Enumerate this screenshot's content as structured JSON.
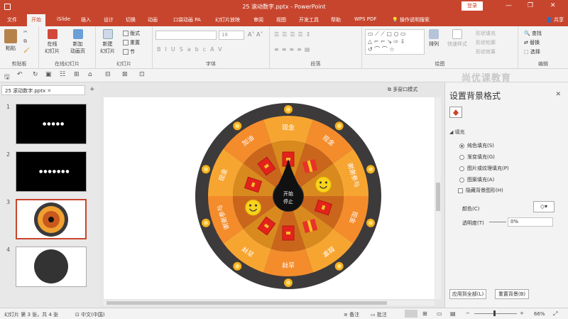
{
  "titlebar": {
    "title": "25 滚动数字.pptx  -  PowerPoint",
    "login": "登录",
    "min": "—",
    "max": "❐",
    "close": "✕"
  },
  "tabs": [
    "文件",
    "开始",
    "iSlide",
    "插入",
    "设计",
    "切换",
    "动画",
    "口袋动画 PA",
    "幻灯片放映",
    "审阅",
    "视图",
    "开发工具",
    "帮助",
    "WPS PDF",
    "操作说明搜索"
  ],
  "share": "共享",
  "ribbon": {
    "paste": "粘贴",
    "clipboard": "剪贴板",
    "new_slide_title": "在线\n幻灯片",
    "new_section": "新加\n动画页",
    "online_slides": "在线幻灯片",
    "new_slide": "新建\n幻灯片",
    "layout": "版式",
    "reset": "重置",
    "section": "节",
    "slides_group": "幻灯片",
    "font_size": "18",
    "font_group": "字体",
    "paragraph_group": "段落",
    "arrange": "排列",
    "quick_styles": "快速样式",
    "shape_fill": "形状填充",
    "shape_outline": "形状轮廓",
    "shape_effect": "形状效果",
    "drawing_group": "绘图",
    "find": "查找",
    "replace": "替换",
    "select": "选择",
    "editing_group": "编辑"
  },
  "watermark": "尚优课教育",
  "doc_tab": "25 滚动数字.pptx",
  "multi_window": "多窗口模式",
  "slides": [
    {
      "num": "1"
    },
    {
      "num": "2"
    },
    {
      "num": "3"
    },
    {
      "num": "4"
    }
  ],
  "wheel": {
    "center_line1": "开始",
    "center_line2": "停止",
    "labels": [
      "现金",
      "现金",
      "谢谢参与",
      "现金",
      "鼓掌",
      "吉祥",
      "吉祥",
      "谢谢参与",
      "现金",
      "加油"
    ]
  },
  "pane": {
    "title": "设置背景格式",
    "section": "填充",
    "options": [
      "纯色填充(S)",
      "渐变填充(G)",
      "图片或纹理填充(P)",
      "图案填充(A)"
    ],
    "hide_bg": "隐藏背景图形(H)",
    "color_label": "颜色(C)",
    "transparency_label": "透明度(T)",
    "transparency_value": "0%",
    "apply_all": "应用到全部(L)",
    "reset_bg": "重置背景(B)"
  },
  "status": {
    "slide_info": "幻灯片 第 3 张，共 4 张",
    "lang": "中文(中国)",
    "notes": "备注",
    "comments": "批注",
    "zoom": "66%"
  }
}
